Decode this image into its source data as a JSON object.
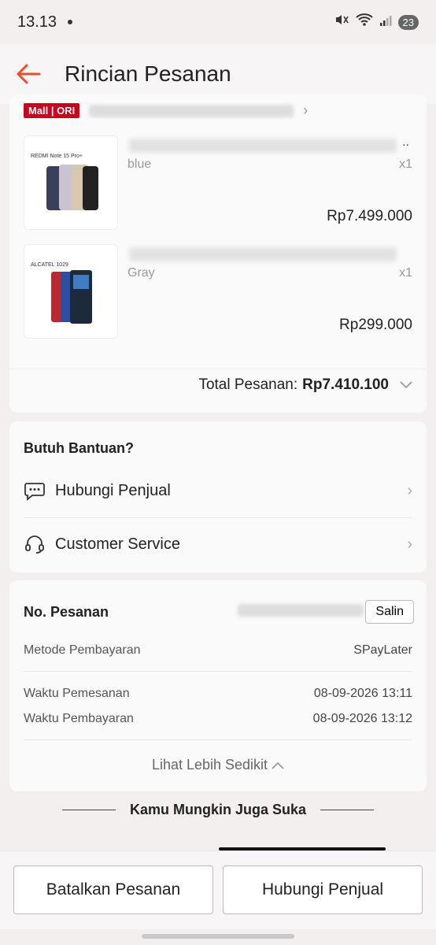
{
  "status_bar": {
    "time": "13.13",
    "battery": "23"
  },
  "header": {
    "title": "Rincian Pesanan"
  },
  "shop": {
    "badge": "Mall | ORI"
  },
  "products": [
    {
      "thumb_label": "REDMI Note 15 Pro+",
      "variant": "blue",
      "qty": "x1",
      "price": "Rp7.499.000"
    },
    {
      "thumb_label": "ALCATEL 1029",
      "variant": "Gray",
      "qty": "x1",
      "price": "Rp299.000"
    }
  ],
  "total": {
    "label": "Total Pesanan:",
    "value": "Rp7.410.100"
  },
  "help": {
    "title": "Butuh Bantuan?",
    "items": [
      {
        "label": "Hubungi Penjual",
        "icon": "chat-icon"
      },
      {
        "label": "Customer Service",
        "icon": "headset-icon"
      }
    ]
  },
  "order": {
    "title": "No. Pesanan",
    "copy_label": "Salin",
    "payment_method_label": "Metode Pembayaran",
    "payment_method_value": "SPayLater",
    "order_time_label": "Waktu Pemesanan",
    "order_time_value": "08-09-2026 13:11",
    "payment_time_label": "Waktu Pembayaran",
    "payment_time_value": "08-09-2026 13:12",
    "see_less": "Lihat Lebih Sedikit"
  },
  "suggestions": {
    "title": "Kamu Mungkin Juga Suka"
  },
  "actions": {
    "cancel": "Batalkan Pesanan",
    "contact": "Hubungi Penjual"
  },
  "colors": {
    "accent": "#ee4d2d",
    "mall": "#d0011b"
  }
}
